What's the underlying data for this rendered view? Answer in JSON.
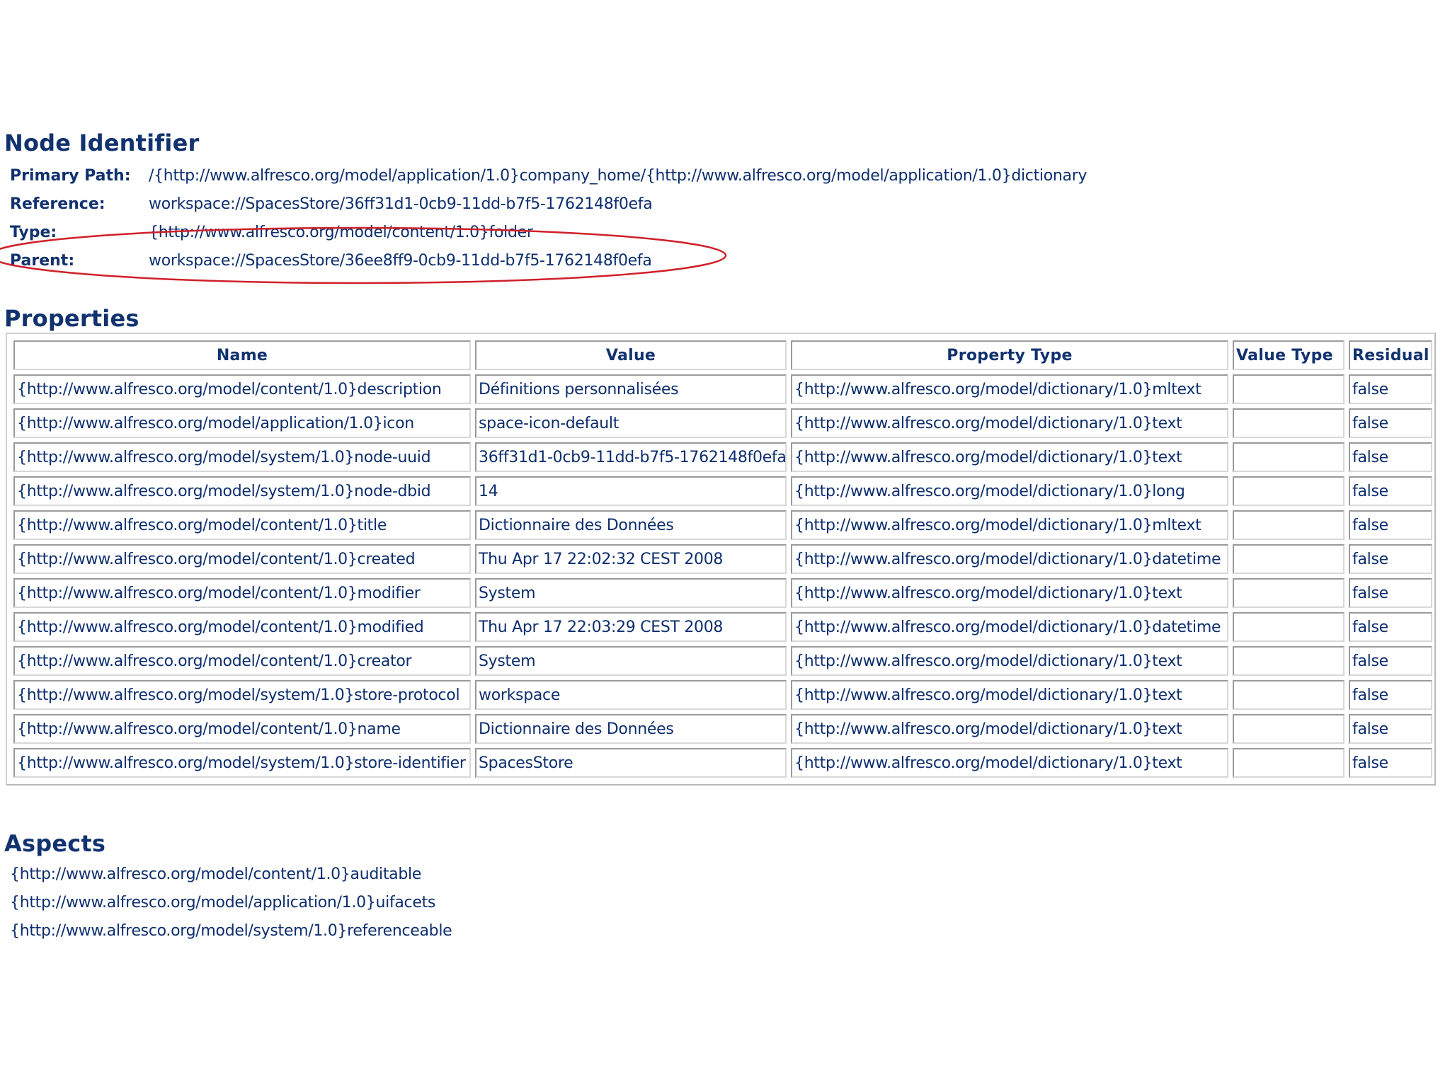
{
  "node_identifier": {
    "title": "Node Identifier",
    "rows": [
      {
        "label": "Primary Path:",
        "value": "/{http://www.alfresco.org/model/application/1.0}company_home/{http://www.alfresco.org/model/application/1.0}dictionary"
      },
      {
        "label": "Reference:",
        "value": "workspace://SpacesStore/36ff31d1-0cb9-11dd-b7f5-1762148f0efa"
      },
      {
        "label": "Type:",
        "value": "{http://www.alfresco.org/model/content/1.0}folder"
      },
      {
        "label": "Parent:",
        "value": "workspace://SpacesStore/36ee8ff9-0cb9-11dd-b7f5-1762148f0efa"
      }
    ],
    "highlight_color": "#d0202a"
  },
  "properties": {
    "title": "Properties",
    "headers": [
      "Name",
      "Value",
      "Property Type",
      "Value Type",
      "Residual"
    ],
    "rows": [
      [
        "{http://www.alfresco.org/model/content/1.0}description",
        "Définitions personnalisées",
        "{http://www.alfresco.org/model/dictionary/1.0}mltext",
        "",
        "false"
      ],
      [
        "{http://www.alfresco.org/model/application/1.0}icon",
        "space-icon-default",
        "{http://www.alfresco.org/model/dictionary/1.0}text",
        "",
        "false"
      ],
      [
        "{http://www.alfresco.org/model/system/1.0}node-uuid",
        "36ff31d1-0cb9-11dd-b7f5-1762148f0efa",
        "{http://www.alfresco.org/model/dictionary/1.0}text",
        "",
        "false"
      ],
      [
        "{http://www.alfresco.org/model/system/1.0}node-dbid",
        "14",
        "{http://www.alfresco.org/model/dictionary/1.0}long",
        "",
        "false"
      ],
      [
        "{http://www.alfresco.org/model/content/1.0}title",
        "Dictionnaire des Données",
        "{http://www.alfresco.org/model/dictionary/1.0}mltext",
        "",
        "false"
      ],
      [
        "{http://www.alfresco.org/model/content/1.0}created",
        "Thu Apr 17 22:02:32 CEST 2008",
        "{http://www.alfresco.org/model/dictionary/1.0}datetime",
        "",
        "false"
      ],
      [
        "{http://www.alfresco.org/model/content/1.0}modifier",
        "System",
        "{http://www.alfresco.org/model/dictionary/1.0}text",
        "",
        "false"
      ],
      [
        "{http://www.alfresco.org/model/content/1.0}modified",
        "Thu Apr 17 22:03:29 CEST 2008",
        "{http://www.alfresco.org/model/dictionary/1.0}datetime",
        "",
        "false"
      ],
      [
        "{http://www.alfresco.org/model/content/1.0}creator",
        "System",
        "{http://www.alfresco.org/model/dictionary/1.0}text",
        "",
        "false"
      ],
      [
        "{http://www.alfresco.org/model/system/1.0}store-protocol",
        "workspace",
        "{http://www.alfresco.org/model/dictionary/1.0}text",
        "",
        "false"
      ],
      [
        "{http://www.alfresco.org/model/content/1.0}name",
        "Dictionnaire des Données",
        "{http://www.alfresco.org/model/dictionary/1.0}text",
        "",
        "false"
      ],
      [
        "{http://www.alfresco.org/model/system/1.0}store-identifier",
        "SpacesStore",
        "{http://www.alfresco.org/model/dictionary/1.0}text",
        "",
        "false"
      ]
    ]
  },
  "aspects": {
    "title": "Aspects",
    "items": [
      "{http://www.alfresco.org/model/content/1.0}auditable",
      "{http://www.alfresco.org/model/application/1.0}uifacets",
      "{http://www.alfresco.org/model/system/1.0}referenceable"
    ]
  }
}
